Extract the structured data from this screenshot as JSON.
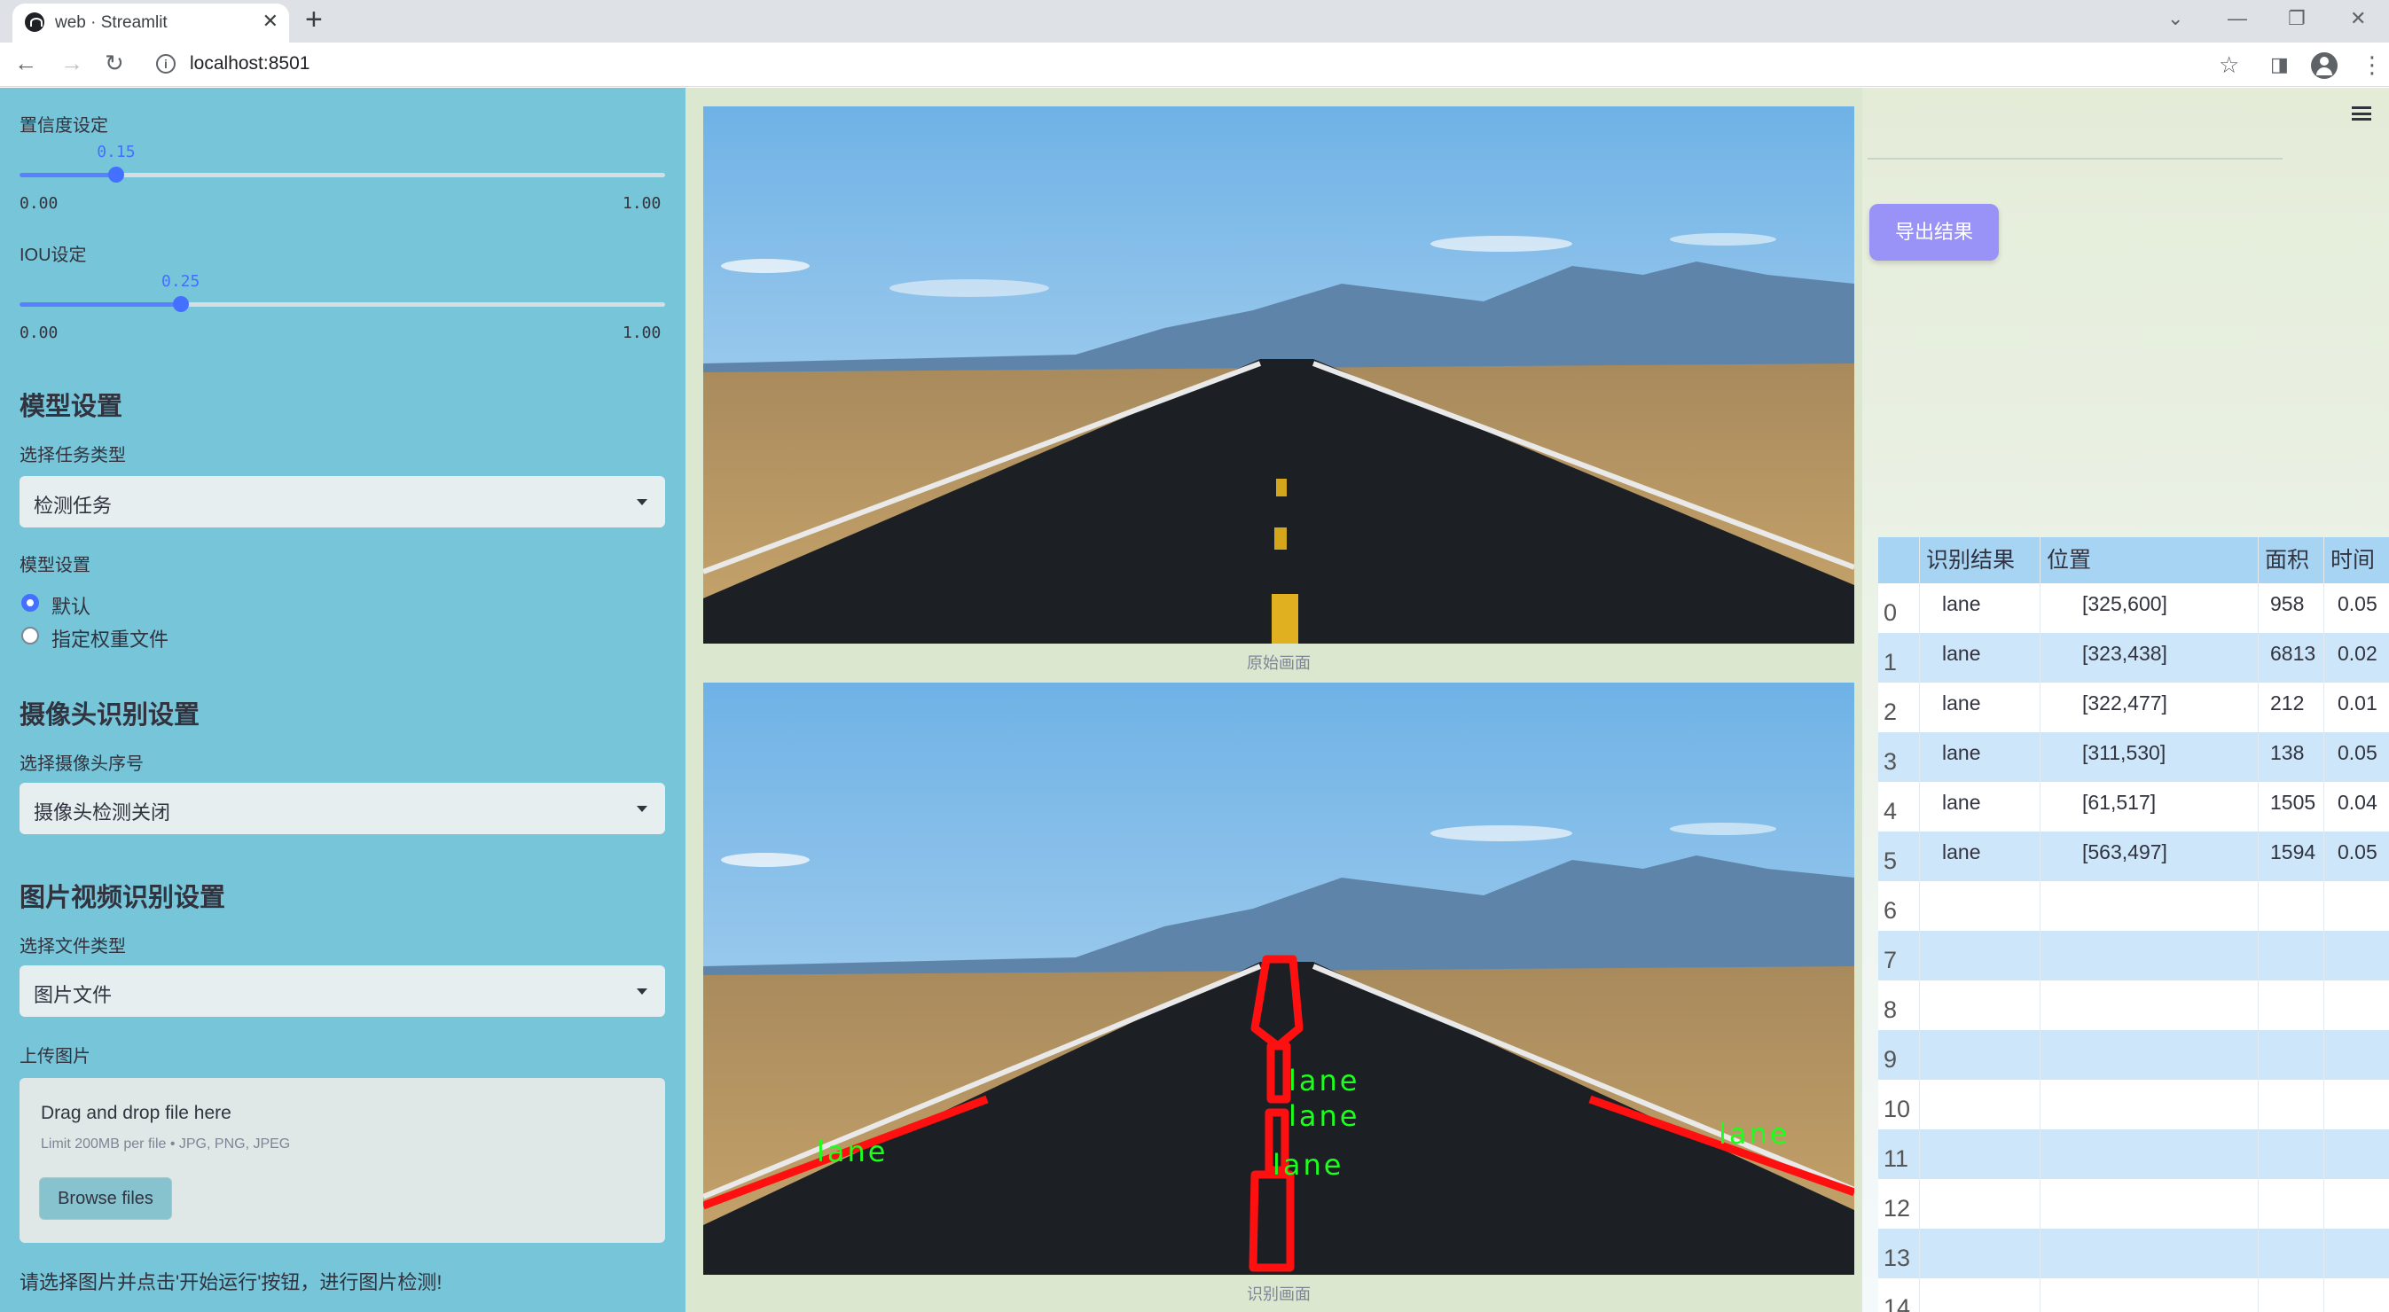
{
  "browser": {
    "tab_title": "web · Streamlit",
    "url": "localhost:8501"
  },
  "sidebar": {
    "confidence": {
      "label": "置信度设定",
      "value": "0.15",
      "min": "0.00",
      "max": "1.00",
      "fraction": 0.15
    },
    "iou": {
      "label": "IOU设定",
      "value": "0.25",
      "min": "0.00",
      "max": "1.00",
      "fraction": 0.25
    },
    "model_section": {
      "title": "模型设置",
      "task_label": "选择任务类型",
      "task_value": "检测任务",
      "model_label": "模型设置",
      "radio_default": "默认",
      "radio_custom": "指定权重文件"
    },
    "camera_section": {
      "title": "摄像头识别设置",
      "camera_label": "选择摄像头序号",
      "camera_value": "摄像头检测关闭"
    },
    "media_section": {
      "title": "图片视频识别设置",
      "filetype_label": "选择文件类型",
      "filetype_value": "图片文件",
      "upload_label": "上传图片",
      "drop_text": "Drag and drop file here",
      "limit_text": "Limit 200MB per file • JPG, PNG, JPEG",
      "browse_label": "Browse files"
    },
    "hint": "请选择图片并点击'开始运行'按钮，进行图片检测!"
  },
  "main": {
    "original_caption": "原始画面",
    "result_caption": "识别画面",
    "export_label": "导出结果",
    "detections": [
      "lane",
      "lane",
      "lane",
      "lane",
      "lane"
    ]
  },
  "table": {
    "headers": [
      "",
      "识别结果",
      "位置",
      "面积",
      "时间"
    ],
    "rows": [
      {
        "idx": "0",
        "result": "lane",
        "pos": "[325,600]",
        "area": "958",
        "time": "0.05"
      },
      {
        "idx": "1",
        "result": "lane",
        "pos": "[323,438]",
        "area": "6813",
        "time": "0.02"
      },
      {
        "idx": "2",
        "result": "lane",
        "pos": "[322,477]",
        "area": "212",
        "time": "0.01"
      },
      {
        "idx": "3",
        "result": "lane",
        "pos": "[311,530]",
        "area": "138",
        "time": "0.05"
      },
      {
        "idx": "4",
        "result": "lane",
        "pos": "[61,517]",
        "area": "1505",
        "time": "0.04"
      },
      {
        "idx": "5",
        "result": "lane",
        "pos": "[563,497]",
        "area": "1594",
        "time": "0.05"
      },
      {
        "idx": "6"
      },
      {
        "idx": "7"
      },
      {
        "idx": "8"
      },
      {
        "idx": "9"
      },
      {
        "idx": "10"
      },
      {
        "idx": "11"
      },
      {
        "idx": "12"
      },
      {
        "idx": "13"
      },
      {
        "idx": "14"
      }
    ]
  },
  "colors": {
    "sidebar": "#76c5d8",
    "accent": "#4470ff",
    "export": "#9a93f7",
    "detection": "#ff0000",
    "label": "#00ff00"
  }
}
